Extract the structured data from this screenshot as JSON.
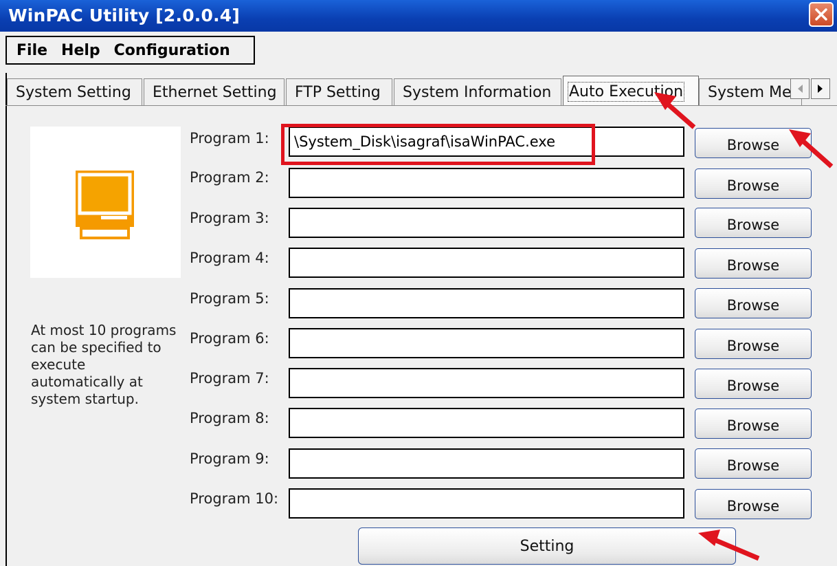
{
  "window": {
    "title": "WinPAC Utility [2.0.0.4]",
    "close_icon": "close-icon"
  },
  "menu": {
    "items": [
      "File",
      "Help",
      "Configuration"
    ]
  },
  "tabs": {
    "items": [
      {
        "label": "System Setting",
        "active": false
      },
      {
        "label": "Ethernet Setting",
        "active": false
      },
      {
        "label": "FTP Setting",
        "active": false
      },
      {
        "label": "System Information",
        "active": false
      },
      {
        "label": "Auto Execution",
        "active": true
      },
      {
        "label": "System Me",
        "active": false
      }
    ],
    "scroll_left_icon": "triangle-left-icon",
    "scroll_right_icon": "triangle-right-icon"
  },
  "auto_execution": {
    "icon": "computer-icon",
    "note": "At most 10 programs can be specified to execute automatically at system startup.",
    "programs": [
      {
        "label": "Program 1:",
        "value": "\\System_Disk\\isagraf\\isaWinPAC.exe",
        "button": "Browse"
      },
      {
        "label": "Program 2:",
        "value": "",
        "button": "Browse"
      },
      {
        "label": "Program 3:",
        "value": "",
        "button": "Browse"
      },
      {
        "label": "Program 4:",
        "value": "",
        "button": "Browse"
      },
      {
        "label": "Program 5:",
        "value": "",
        "button": "Browse"
      },
      {
        "label": "Program 6:",
        "value": "",
        "button": "Browse"
      },
      {
        "label": "Program 7:",
        "value": "",
        "button": "Browse"
      },
      {
        "label": "Program 8:",
        "value": "",
        "button": "Browse"
      },
      {
        "label": "Program 9:",
        "value": "",
        "button": "Browse"
      },
      {
        "label": "Program 10:",
        "value": "",
        "button": "Browse"
      }
    ],
    "setting_button": "Setting"
  },
  "colors": {
    "title_bar": "#0a3fb2",
    "annotation": "#e0141e",
    "icon_accent": "#f59a00"
  }
}
